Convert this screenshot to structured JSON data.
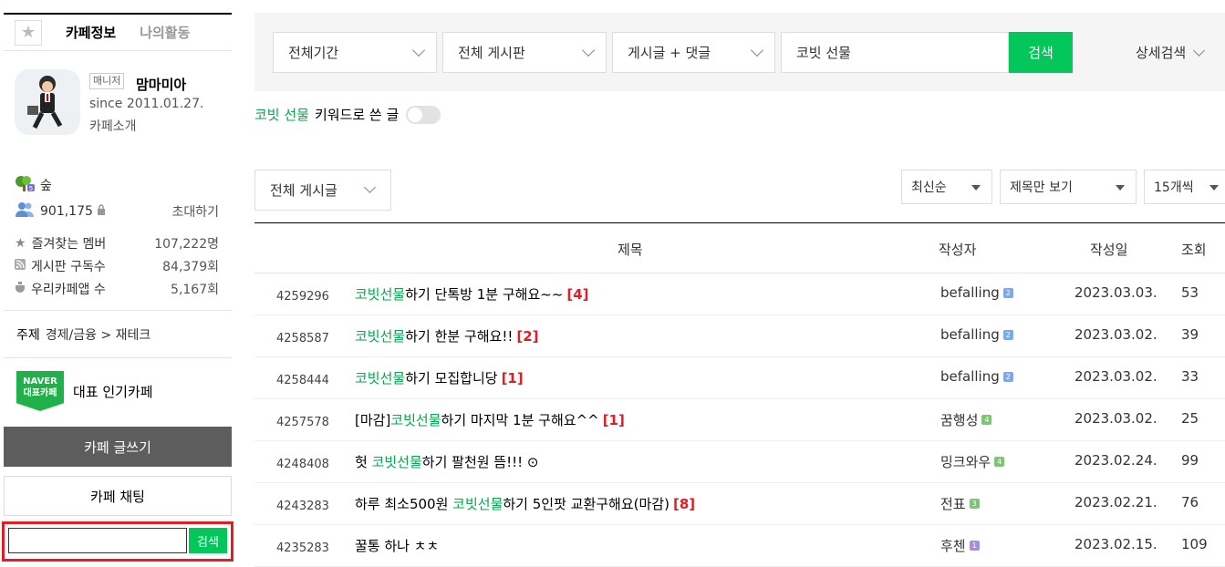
{
  "sidebar": {
    "tab_info": "카페정보",
    "tab_activity": "나의활동",
    "manager_badge": "매니저",
    "nickname": "맘마미아",
    "since": "since 2011.01.27.",
    "cafe_intro": "카페소개",
    "level": "숲",
    "members": "901,175",
    "invite": "초대하기",
    "stats": [
      {
        "label": "즐겨찾는 멤버",
        "value": "107,222명"
      },
      {
        "label": "게시판 구독수",
        "value": "84,379회"
      },
      {
        "label": "우리카페앱 수",
        "value": "5,167회"
      }
    ],
    "topic_label": "주제",
    "topic_value": "경제/금융 > 재테크",
    "naver_badge_line1": "NAVER",
    "naver_badge_line2": "대표카페",
    "naver_rep": "대표 인기카페",
    "write_button": "카페 글쓰기",
    "chat_button": "카페 채팅",
    "search_input_value": "",
    "search_button": "검색"
  },
  "search": {
    "period": "전체기간",
    "board": "전체 게시판",
    "scope": "게시글 + 댓글",
    "keyword": "코빗 선물",
    "button": "검색",
    "detail": "상세검색"
  },
  "keyword_toggle": {
    "keyword": "코빗 선물",
    "label": "키워드로 쓴 글",
    "enabled": false
  },
  "filters": {
    "board_filter": "전체 게시글",
    "sort": "최신순",
    "view_mode": "제목만 보기",
    "per_page": "15개씩"
  },
  "table": {
    "headers": {
      "title": "제목",
      "author": "작성자",
      "date": "작성일",
      "views": "조회"
    },
    "rows": [
      {
        "no": "4259296",
        "prefix": "",
        "keyword": "코빗선물",
        "suffix": "하기 단톡방 1분 구해요~~",
        "comments": "[4]",
        "author": "befalling",
        "level_color": "#7fa8e6",
        "level_glyph": "2",
        "date": "2023.03.03.",
        "views": "53"
      },
      {
        "no": "4258587",
        "prefix": "",
        "keyword": "코빗선물",
        "suffix": "하기 한분 구해요!!",
        "comments": "[2]",
        "author": "befalling",
        "level_color": "#7fa8e6",
        "level_glyph": "2",
        "date": "2023.03.02.",
        "views": "39"
      },
      {
        "no": "4258444",
        "prefix": "",
        "keyword": "코빗선물",
        "suffix": "하기 모집합니당",
        "comments": "[1]",
        "author": "befalling",
        "level_color": "#7fa8e6",
        "level_glyph": "2",
        "date": "2023.03.02.",
        "views": "33"
      },
      {
        "no": "4257578",
        "prefix": "[마감]",
        "keyword": "코빗선물",
        "suffix": "하기 마지막 1분 구해요^^",
        "comments": "[1]",
        "author": "꿈행성",
        "level_color": "#7cc576",
        "level_glyph": "4",
        "date": "2023.03.02.",
        "views": "25"
      },
      {
        "no": "4248408",
        "prefix": "헛 ",
        "keyword": "코빗선물",
        "suffix": "하기 팔천원 뜸!!! ⊙",
        "comments": "",
        "author": "밍크와우",
        "level_color": "#7cc576",
        "level_glyph": "4",
        "date": "2023.02.24.",
        "views": "99"
      },
      {
        "no": "4243283",
        "prefix": "하루 최소500원 ",
        "keyword": "코빗선물",
        "suffix": "하기 5인팟 교환구해요(마감)",
        "comments": "[8]",
        "author": "전표",
        "level_color": "#7cc576",
        "level_glyph": "3",
        "date": "2023.02.21.",
        "views": "76"
      },
      {
        "no": "4235283",
        "prefix": "꿀통 하나 ㅊㅊ",
        "keyword": "",
        "suffix": "",
        "comments": "",
        "author": "후첸",
        "level_color": "#a98be0",
        "level_glyph": "1",
        "date": "2023.02.15.",
        "views": "109"
      }
    ]
  }
}
